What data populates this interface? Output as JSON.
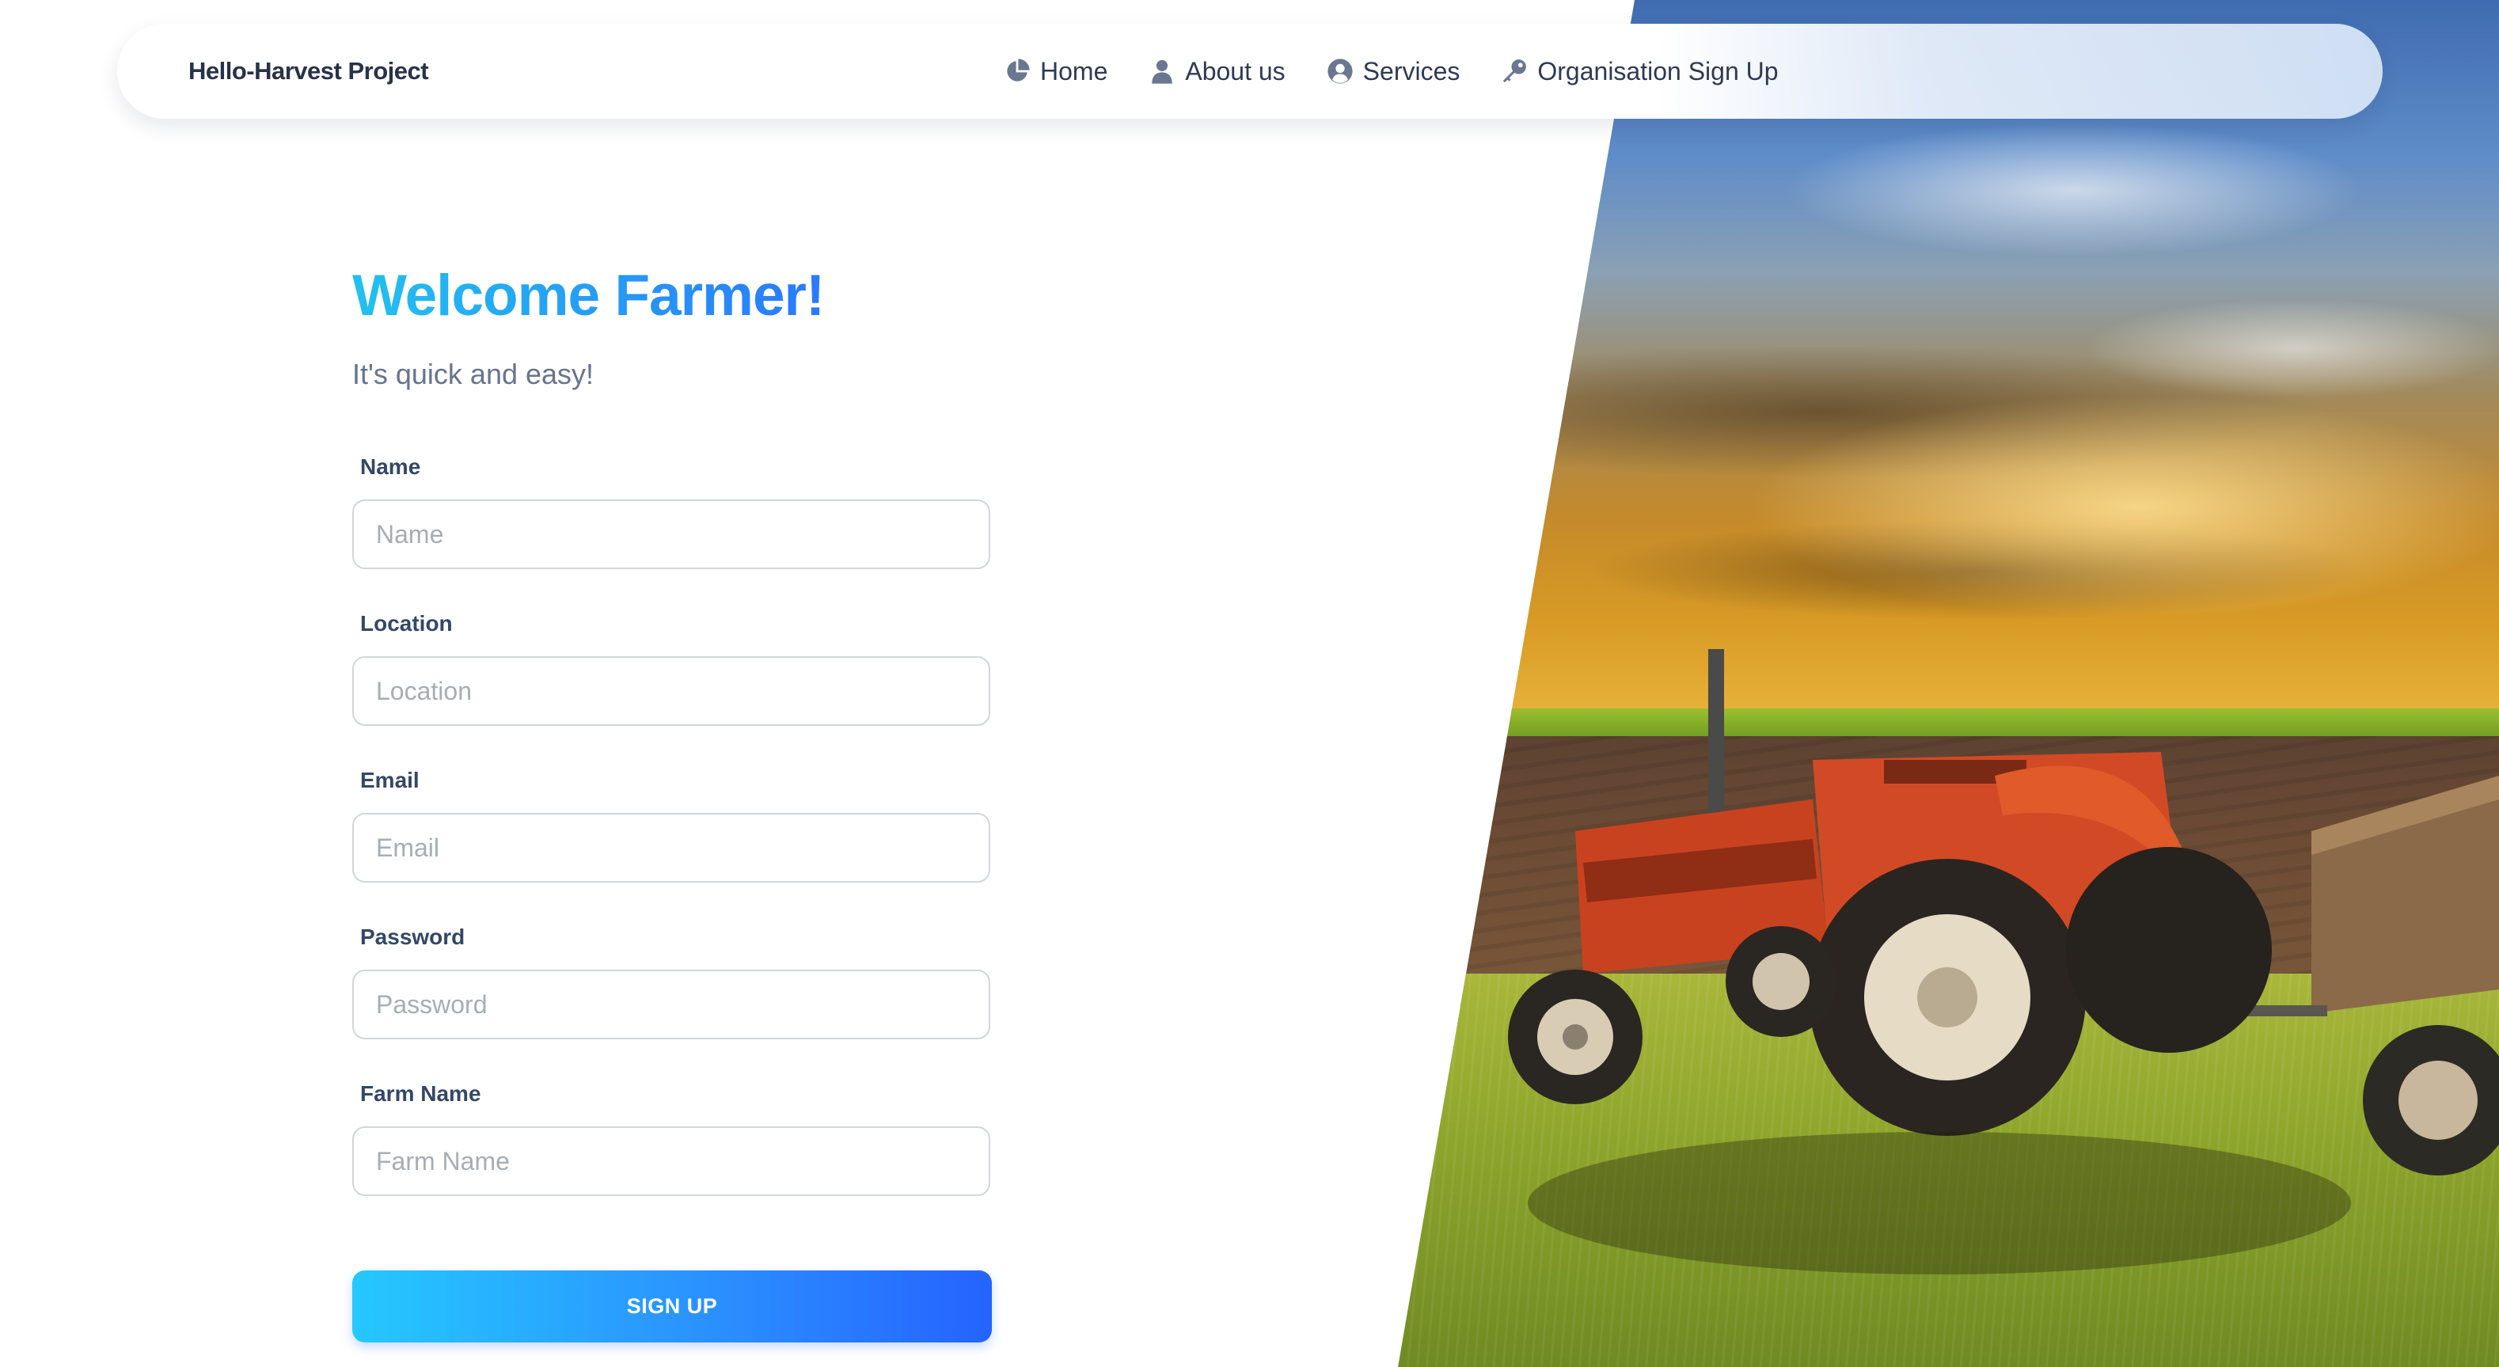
{
  "navbar": {
    "brand": "Hello-Harvest Project",
    "items": [
      {
        "label": "Home",
        "icon": "pie-chart-icon"
      },
      {
        "label": "About us",
        "icon": "user-icon"
      },
      {
        "label": "Services",
        "icon": "user-circle-icon"
      },
      {
        "label": "Organisation Sign Up",
        "icon": "key-icon"
      }
    ]
  },
  "form": {
    "title": "Welcome Farmer!",
    "subtitle": "It's quick and easy!",
    "fields": [
      {
        "label": "Name",
        "placeholder": "Name",
        "value": ""
      },
      {
        "label": "Location",
        "placeholder": "Location",
        "value": ""
      },
      {
        "label": "Email",
        "placeholder": "Email",
        "value": ""
      },
      {
        "label": "Password",
        "placeholder": "Password",
        "value": ""
      },
      {
        "label": "Farm Name",
        "placeholder": "Farm Name",
        "value": ""
      }
    ],
    "submit_label": "SIGN UP"
  },
  "theme": {
    "accent_start": "#22c1ee",
    "accent_end": "#2979ff",
    "text_dark": "#344767",
    "text_muted": "#67748e"
  }
}
